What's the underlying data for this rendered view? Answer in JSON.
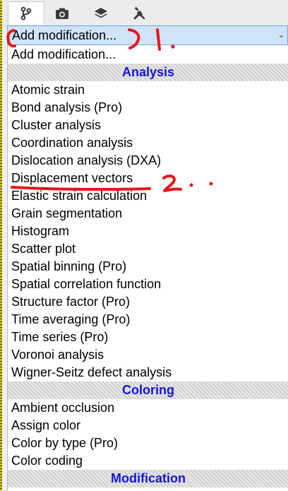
{
  "tabs": [
    {
      "icon": "pipeline-branch-icon",
      "active": true
    },
    {
      "icon": "camera-icon",
      "active": false
    },
    {
      "icon": "layers-icon",
      "active": false
    },
    {
      "icon": "tools-icon",
      "active": false
    }
  ],
  "combo": {
    "selected_label": "Add modification...",
    "arrow_icon": "chevron-down-icon"
  },
  "dropdown": {
    "first_item": "Add modification...",
    "sections": [
      {
        "header": "Analysis",
        "items": [
          "Atomic strain",
          "Bond analysis (Pro)",
          "Cluster analysis",
          "Coordination analysis",
          "Dislocation analysis (DXA)",
          "Displacement vectors",
          "Elastic strain calculation",
          "Grain segmentation",
          "Histogram",
          "Scatter plot",
          "Spatial binning (Pro)",
          "Spatial correlation function",
          "Structure factor (Pro)",
          "Time averaging (Pro)",
          "Time series (Pro)",
          "Voronoi analysis",
          "Wigner-Seitz defect analysis"
        ]
      },
      {
        "header": "Coloring",
        "items": [
          "Ambient occlusion",
          "Assign color",
          "Color by type (Pro)",
          "Color coding"
        ]
      },
      {
        "header": "Modification",
        "items": []
      }
    ]
  },
  "annotations": {
    "color": "#e8141c",
    "mark_1": "1.",
    "mark_2": "2."
  },
  "colors": {
    "header_text": "#1414d6",
    "combo_highlight": "#cfe3fa",
    "combo_border": "#6fa6e0"
  }
}
